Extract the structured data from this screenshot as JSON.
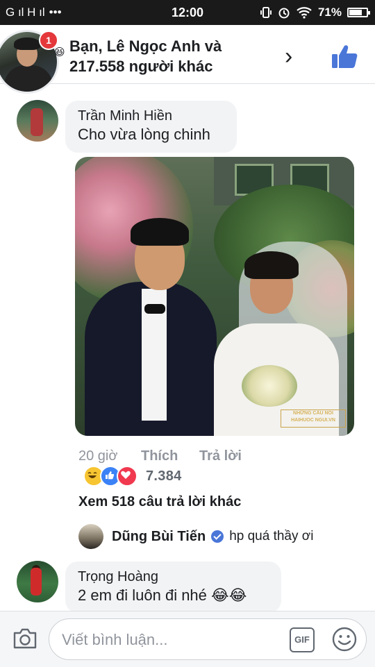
{
  "status_bar": {
    "signal_text": "G ıl H ıl",
    "more": "•••",
    "time": "12:00",
    "battery_percent": "71%",
    "battery_level": 0.71
  },
  "reactions_header": {
    "line1": "Bạn, Lê Ngọc Anh và",
    "line2": "217.558 người khác",
    "notification_count": "1"
  },
  "comment1": {
    "author": "Trần Minh Hiền",
    "text": "Cho vừa lòng chinh",
    "photo_watermark": "NHỮNG CÂU NÓI\nHAIHUOC NGUI.VN",
    "time": "20 giờ",
    "like_label": "Thích",
    "reply_label": "Trả lời",
    "reaction_count": "7.384",
    "more_replies": "Xem 518 câu trả lời khác"
  },
  "reply": {
    "author": "Dũng Bùi Tiến",
    "text": "hp quá thầy ơi"
  },
  "comment2": {
    "author": "Trọng Hoàng",
    "text": "2 em đi luôn đi nhé 😂😂"
  },
  "composer": {
    "placeholder": "Viết bình luận...",
    "gif_label": "GIF"
  },
  "colors": {
    "facebook_blue": "#4a76d8",
    "bubble": "#f2f3f5",
    "notification_red": "#e4383b"
  }
}
